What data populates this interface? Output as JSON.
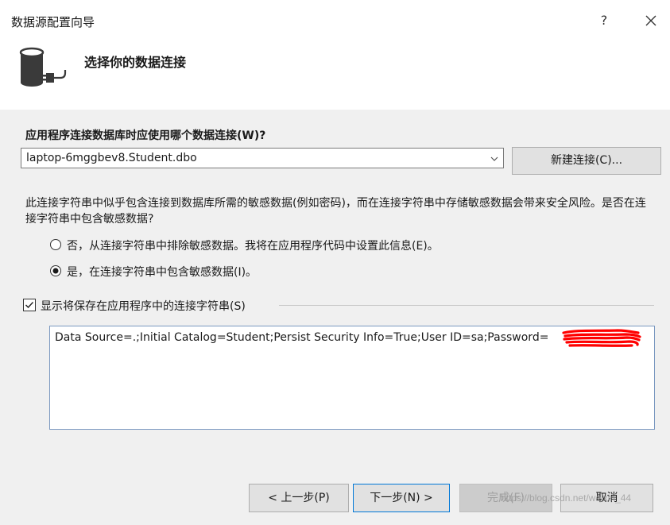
{
  "window": {
    "title": "数据源配置向导",
    "help_label": "?"
  },
  "header": {
    "title": "选择你的数据连接",
    "icon": "database-plug-icon"
  },
  "connection": {
    "label": "应用程序连接数据库时应使用哪个数据连接(W)?",
    "selected_value": "laptop-6mggbev8.Student.dbo",
    "new_button_label": "新建连接(C)..."
  },
  "sensitive": {
    "description": "此连接字符串中似乎包含连接到数据库所需的敏感数据(例如密码)，而在连接字符串中存储敏感数据会带来安全风险。是否在连接字符串中包含敏感数据?",
    "options": [
      {
        "label": "否，从连接字符串中排除敏感数据。我将在应用程序代码中设置此信息(E)。",
        "selected": false
      },
      {
        "label": "是，在连接字符串中包含敏感数据(I)。",
        "selected": true
      }
    ]
  },
  "connection_string": {
    "show_label": "显示将保存在应用程序中的连接字符串(S)",
    "show_checked": true,
    "value": "Data Source=.;Initial Catalog=Student;Persist Security Info=True;User ID=sa;Password="
  },
  "footer": {
    "prev_label": "< 上一步(P)",
    "next_label": "下一步(N) >",
    "finish_label": "完成(F)",
    "cancel_label": "取消"
  },
  "watermark": "https://blog.csdn.net/weixin_44",
  "colors": {
    "accent": "#0078d7",
    "redaction": "#ff0000",
    "dialog_bg": "#f0f0f0"
  }
}
